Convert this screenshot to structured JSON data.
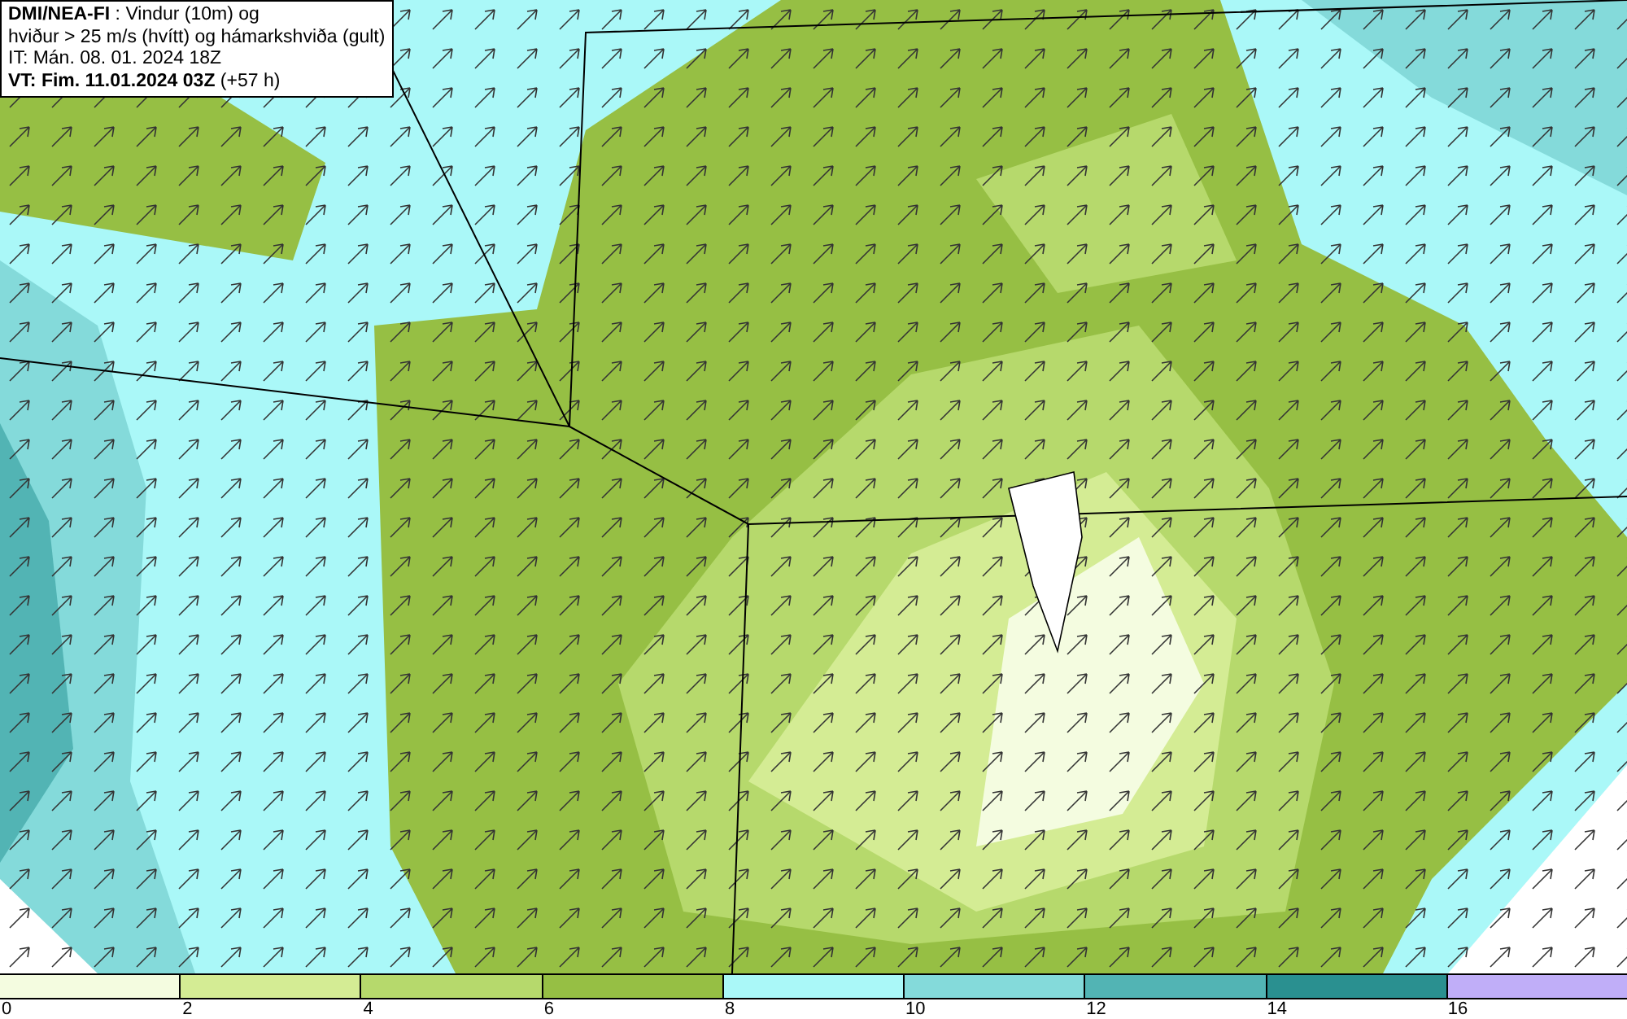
{
  "info_box": {
    "lines": [
      "**DMI/NEA-FI** : Vindur (10m) og",
      "hviður > 25 m/s (hvítt) og hámarkshviða (gult)",
      "IT: Mán. 08. 01. 2024 18Z",
      "**VT: Fim. 11.01.2024 03Z** (+57 h)"
    ]
  },
  "legend": {
    "segments": [
      {
        "color": "#f4fce0"
      },
      {
        "color": "#d4ec94"
      },
      {
        "color": "#b6d96c"
      },
      {
        "color": "#96bf44"
      },
      {
        "color": "#aaf8f8"
      },
      {
        "color": "#84dada"
      },
      {
        "color": "#52b4b4"
      },
      {
        "color": "#2a9090"
      },
      {
        "color": "#c0aef8"
      }
    ],
    "ticks": [
      "0",
      "2",
      "4",
      "6",
      "8",
      "10",
      "12",
      "14",
      "16"
    ]
  }
}
